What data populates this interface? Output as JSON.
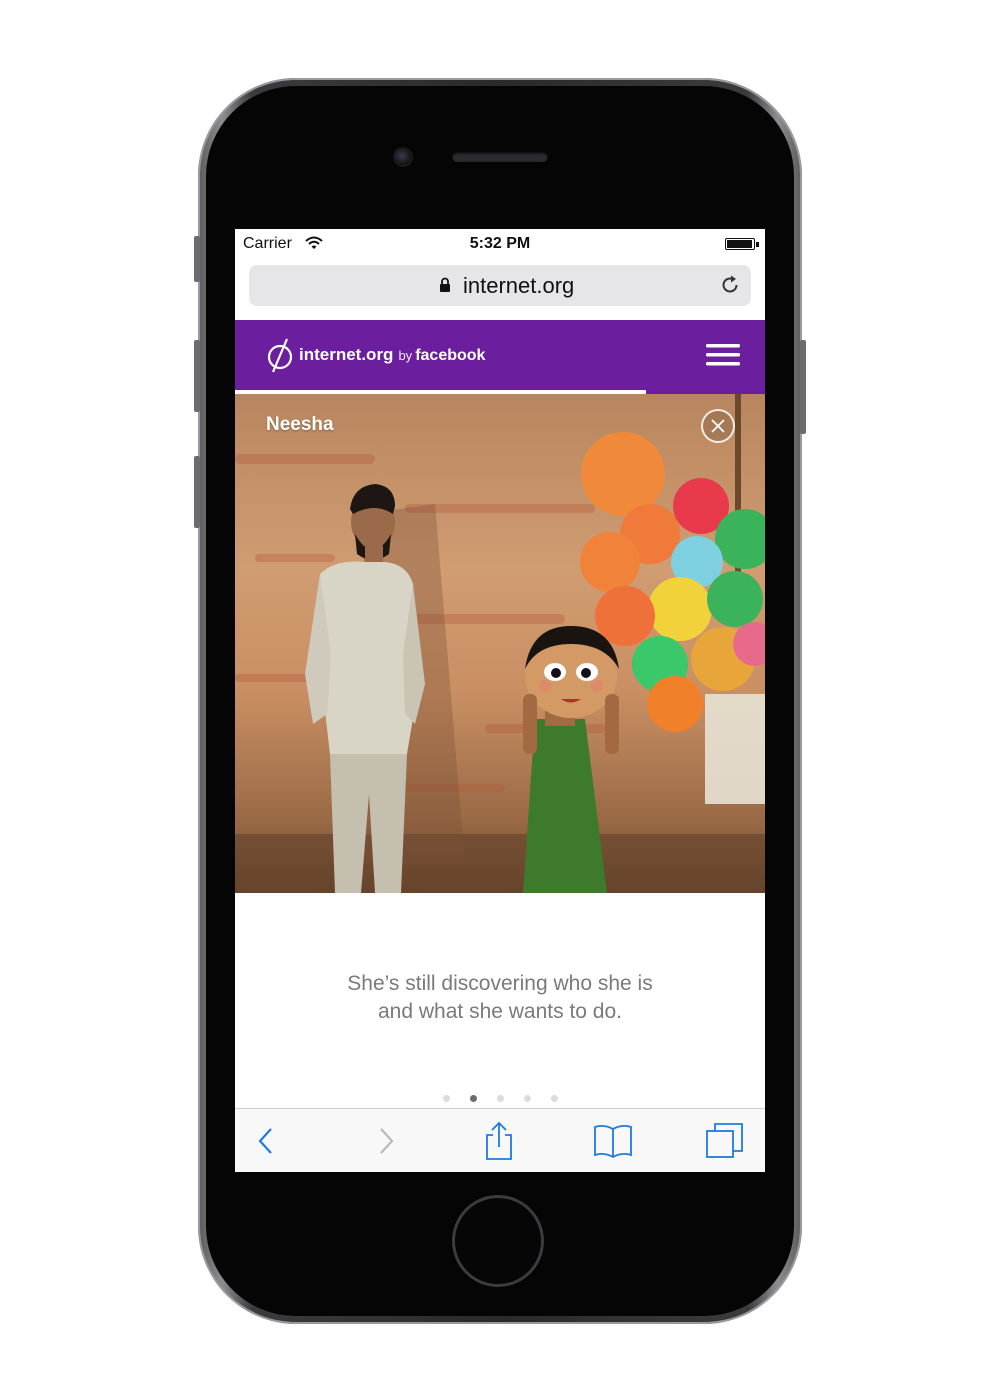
{
  "status_bar": {
    "carrier": "Carrier",
    "time": "5:32 PM",
    "battery_level": 0.95
  },
  "browser": {
    "url": "internet.org"
  },
  "site_header": {
    "site": "internet.org",
    "by": "by",
    "brand": "facebook",
    "color": "#6b1f9e",
    "story_progress": 0.775
  },
  "story": {
    "name": "Neesha",
    "caption_lines": [
      "She’s still discovering who she is",
      "and what she wants to do."
    ],
    "page_count": 5,
    "current_page": 2
  },
  "toolbar": {
    "icons": [
      "back-chevron-icon",
      "forward-chevron-icon",
      "share-icon",
      "bookmarks-icon",
      "tabs-icon"
    ],
    "accent_color": "#1f7ae0",
    "disabled_color": "#b9b9b9"
  }
}
